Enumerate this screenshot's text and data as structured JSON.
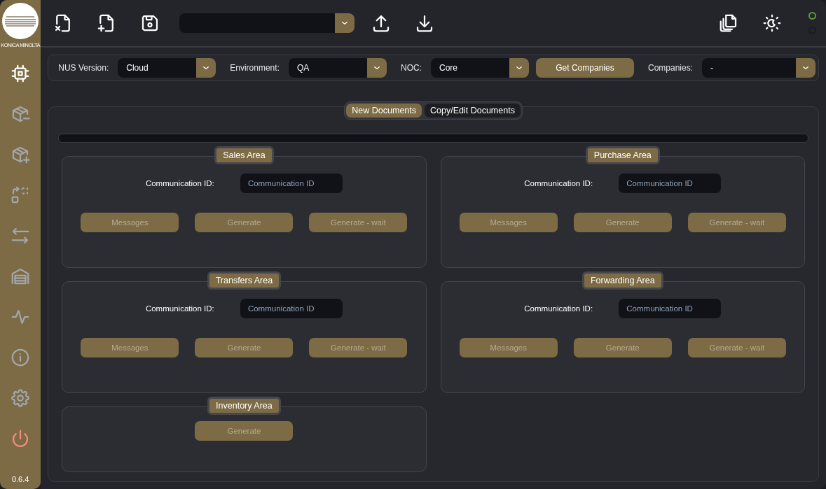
{
  "sidebar": {
    "logo_text": "KONICA MINOLTA",
    "items": [
      {
        "selected": true
      },
      {
        "selected": false
      },
      {
        "selected": false
      },
      {
        "selected": false
      },
      {
        "selected": false
      },
      {
        "selected": false
      },
      {
        "selected": false
      },
      {
        "selected": false
      },
      {
        "selected": false
      }
    ],
    "version": "0.6.4"
  },
  "toolbar": {
    "indicators": [
      {
        "on": true
      },
      {
        "on": false
      }
    ]
  },
  "filters": [
    {
      "label": "NUS Version:",
      "value": "Cloud"
    },
    {
      "label": "Environment:",
      "value": "QA"
    },
    {
      "label": "NOC:",
      "value": "Core"
    }
  ],
  "get_companies_button": "Get Companies",
  "companies": {
    "label": "Companies:",
    "value": "-"
  },
  "progress": {
    "level": 0
  },
  "tabs": [
    {
      "label": "New Documents",
      "selected": true
    },
    {
      "label": "Copy/Edit Documents",
      "selected": false
    }
  ],
  "areas": [
    {
      "title": "Sales Area",
      "field_label": "Communication ID:",
      "placeholder": "Communication ID",
      "buttons": [
        {
          "label": "Messages",
          "disabled": true
        },
        {
          "label": "Generate",
          "disabled": true
        },
        {
          "label": "Generate - wait",
          "disabled": true
        }
      ]
    },
    {
      "title": "Purchase Area",
      "field_label": "Communication ID:",
      "placeholder": "Communication ID",
      "buttons": [
        {
          "label": "Messages",
          "disabled": true
        },
        {
          "label": "Generate",
          "disabled": true
        },
        {
          "label": "Generate - wait",
          "disabled": true
        }
      ]
    },
    {
      "title": "Transfers Area",
      "field_label": "Communication ID:",
      "placeholder": "Communication ID",
      "buttons": [
        {
          "label": "Messages",
          "disabled": true
        },
        {
          "label": "Generate",
          "disabled": true
        },
        {
          "label": "Generate - wait",
          "disabled": true
        }
      ]
    },
    {
      "title": "Forwarding Area",
      "field_label": "Communication ID:",
      "placeholder": "Communication ID",
      "buttons": [
        {
          "label": "Messages",
          "disabled": true
        },
        {
          "label": "Generate",
          "disabled": true
        },
        {
          "label": "Generate - wait",
          "disabled": true
        }
      ]
    },
    {
      "title": "Inventory Area",
      "buttons": [
        {
          "label": "Generate",
          "disabled": true
        }
      ]
    }
  ]
}
